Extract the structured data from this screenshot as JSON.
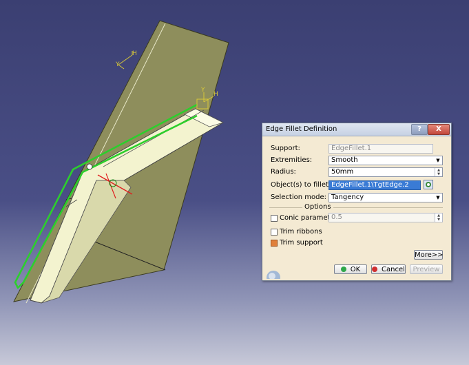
{
  "viewport": {
    "support_axis_labels": [
      "Y",
      "H"
    ],
    "fillet_axis_labels": [
      "Y",
      "H"
    ]
  },
  "dialog": {
    "title": "Edge Fillet Definition",
    "help_label": "?",
    "close_label": "X",
    "support_label": "Support:",
    "support_value": "EdgeFillet.1",
    "extremities_label": "Extremities:",
    "extremities_value": "Smooth",
    "radius_label": "Radius:",
    "radius_value": "50mm",
    "objects_label": "Object(s) to fillet:",
    "objects_value": "EdgeFillet.1\\TgtEdge.2",
    "selection_mode_label": "Selection mode:",
    "selection_mode_value": "Tangency",
    "options_label": "Options",
    "conic_label": "Conic parameter:",
    "conic_value": "0.5",
    "conic_checked": false,
    "trim_ribbons_label": "Trim ribbons",
    "trim_ribbons_checked": false,
    "trim_support_label": "Trim support",
    "trim_support_checked": true,
    "more_label": "More>>",
    "ok_label": "OK",
    "cancel_label": "Cancel",
    "preview_label": "Preview"
  },
  "colors": {
    "plane": "#8c8c5a",
    "part": "#f4f4d4",
    "highlight": "#2ccf2c",
    "axis": "#d8c838",
    "ok_dot": "#2fa84a",
    "cancel_dot": "#d03030"
  }
}
